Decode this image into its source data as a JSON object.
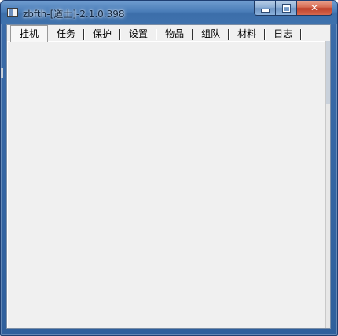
{
  "window": {
    "title": "zbfth-[道士]-2.1.0.398",
    "app_icon": "window-app-icon",
    "caption_buttons": {
      "minimize_icon": "minimize-icon",
      "maximize_icon": "maximize-icon",
      "close_label": "✕"
    }
  },
  "tabs": [
    {
      "label": "挂机",
      "selected": true
    },
    {
      "label": "任务",
      "selected": false
    },
    {
      "label": "保护",
      "selected": false
    },
    {
      "label": "设置",
      "selected": false
    },
    {
      "label": "物品",
      "selected": false
    },
    {
      "label": "组队",
      "selected": false
    },
    {
      "label": "材料",
      "selected": false
    },
    {
      "label": "日志",
      "selected": false
    }
  ],
  "colors": {
    "titlebar": "#3f72ad",
    "close_button": "#c0412a",
    "client_background": "#f0f0f0"
  }
}
